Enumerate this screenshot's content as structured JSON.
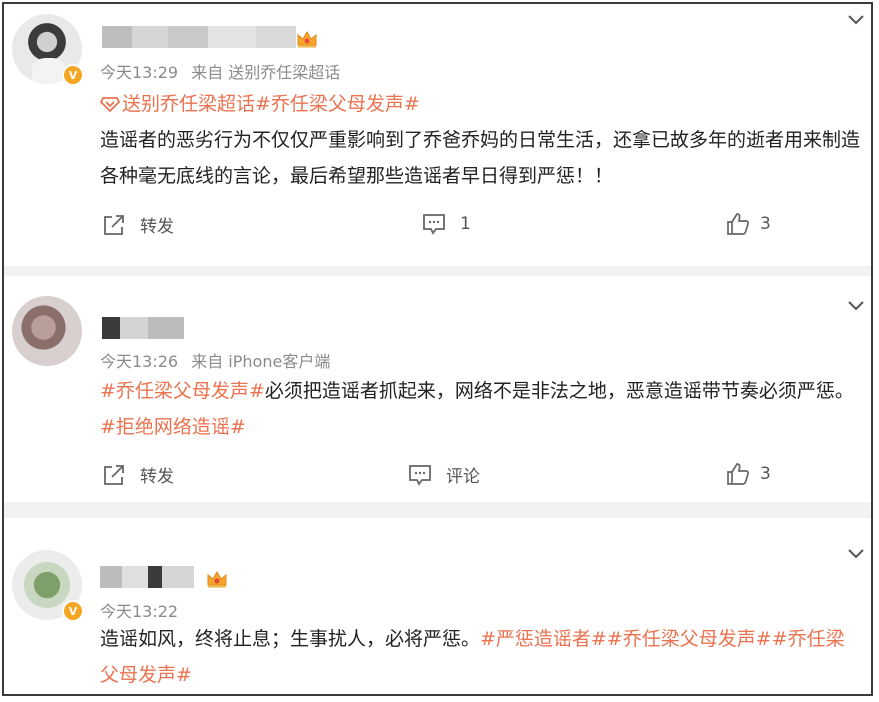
{
  "posts": [
    {
      "time": "今天13:29",
      "source": "来自 送别乔任梁超话",
      "super_topic": "送别乔任梁超话#乔任梁父母发声#",
      "text": "造谣者的恶劣行为不仅仅严重影响到了乔爸乔妈的日常生活，还拿已故多年的逝者用来制造各种毫无底线的言论，最后希望那些造谣者早日得到严惩！！",
      "repost_label": "转发",
      "comment_value": "1",
      "like_count": "3"
    },
    {
      "time": "今天13:26",
      "source": "来自 iPhone客户端",
      "tag1": "#乔任梁父母发声#",
      "text1": "必须把造谣者抓起来，网络不是非法之地，恶意造谣带节奏必须严惩。",
      "tag2": "#拒绝网络造谣#",
      "repost_label": "转发",
      "comment_value": "评论",
      "like_count": "3"
    },
    {
      "time": "今天13:22",
      "text": "造谣如风，终将止息；生事扰人，必将严惩。",
      "tags": "#严惩造谣者##乔任梁父母发声##乔任梁父母发声#"
    }
  ],
  "icons": {
    "verified": "verified-badge",
    "crown": "crown-icon",
    "repost": "share-icon",
    "comment": "comment-icon",
    "like": "thumbs-up-icon",
    "menu": "chevron-down-icon"
  },
  "colors": {
    "accent": "#eb7350",
    "meta": "#8b8b8b",
    "text": "#222222",
    "divider": "#f2f2f2"
  }
}
